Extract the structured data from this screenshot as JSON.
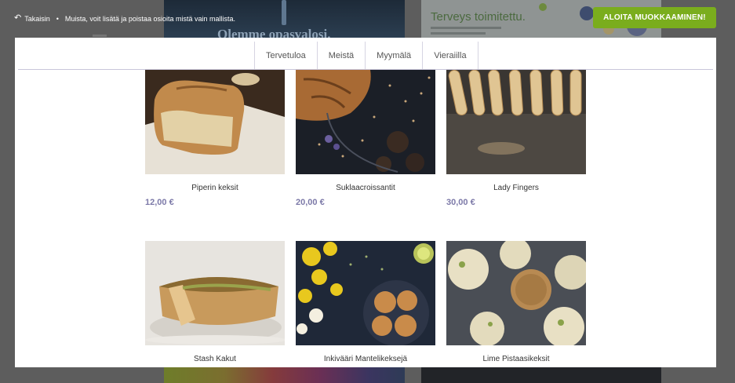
{
  "topbar": {
    "back_label": "Takaisin",
    "separator": "•",
    "notice": "Muista, voit lisätä ja poistaa osioita mistä vain mallista.",
    "cta_label": "ALOITA MUOKKAAMINEN!"
  },
  "background_previews": {
    "left_headline": "Olemme opasvalosi.",
    "right_headline": "Terveys toimitettu."
  },
  "nav": {
    "tabs": [
      "Tervetuloa",
      "Meistä",
      "Myymälä",
      "Vieraiilla"
    ]
  },
  "products": [
    {
      "name": "Piperin keksit",
      "price": "12,00 €",
      "image": "bread-loaf-photo"
    },
    {
      "name": "Suklaacroissantit",
      "price": "20,00 €",
      "image": "croissant-photo"
    },
    {
      "name": "Lady Fingers",
      "price": "30,00 €",
      "image": "lady-fingers-photo"
    },
    {
      "name": "Stash Kakut",
      "price": "",
      "image": "quiche-photo"
    },
    {
      "name": "Inkivääri Mantelikeksejä",
      "price": "",
      "image": "almond-cookies-photo"
    },
    {
      "name": "Lime Pistaasikeksit",
      "price": "",
      "image": "pistachio-cookies-photo"
    }
  ],
  "colors": {
    "cta": "#7aad1d",
    "price": "#7c79a8",
    "overlay": "#5d5d5d"
  }
}
